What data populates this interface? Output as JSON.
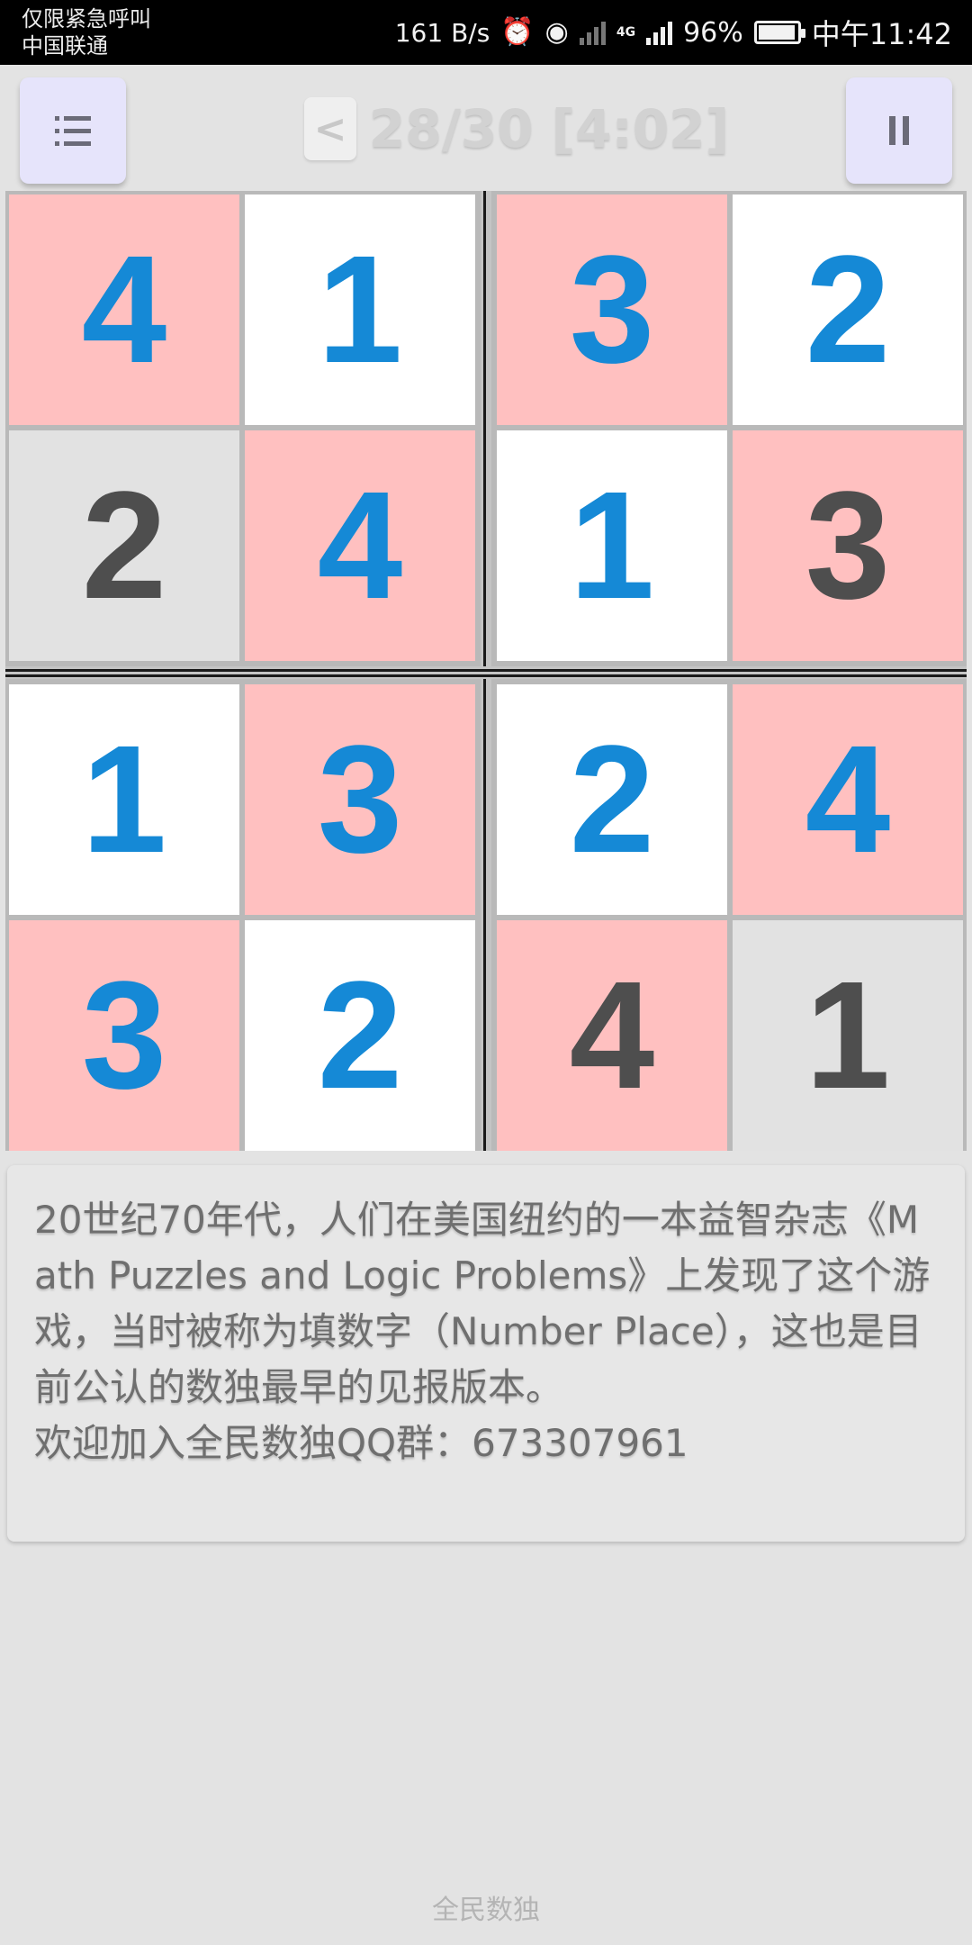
{
  "status_bar": {
    "line1": "仅限紧急呼叫",
    "line2": "中国联通",
    "speed": "161 B/s",
    "network": "4G",
    "battery": "96%",
    "battery_level": 0.96,
    "time": "中午11:42"
  },
  "header": {
    "back_label": "<",
    "progress": "28/30 [4:02]"
  },
  "colors": {
    "pink": "#ffc0c0",
    "white": "#ffffff",
    "grey": "#e2e2e2",
    "blue": "#1589d6",
    "dark": "#4e4e4e"
  },
  "grid": {
    "rows": [
      [
        {
          "value": "4",
          "bg": "pink",
          "fg": "blue"
        },
        {
          "value": "1",
          "bg": "white",
          "fg": "blue"
        },
        {
          "value": "3",
          "bg": "pink",
          "fg": "blue"
        },
        {
          "value": "2",
          "bg": "white",
          "fg": "blue"
        }
      ],
      [
        {
          "value": "2",
          "bg": "grey",
          "fg": "dark"
        },
        {
          "value": "4",
          "bg": "pink",
          "fg": "blue"
        },
        {
          "value": "1",
          "bg": "white",
          "fg": "blue"
        },
        {
          "value": "3",
          "bg": "pink",
          "fg": "dark"
        }
      ],
      [
        {
          "value": "1",
          "bg": "white",
          "fg": "blue"
        },
        {
          "value": "3",
          "bg": "pink",
          "fg": "blue"
        },
        {
          "value": "2",
          "bg": "white",
          "fg": "blue"
        },
        {
          "value": "4",
          "bg": "pink",
          "fg": "blue"
        }
      ],
      [
        {
          "value": "3",
          "bg": "pink",
          "fg": "blue"
        },
        {
          "value": "2",
          "bg": "white",
          "fg": "blue"
        },
        {
          "value": "4",
          "bg": "pink",
          "fg": "dark"
        },
        {
          "value": "1",
          "bg": "grey",
          "fg": "dark"
        }
      ]
    ]
  },
  "info": {
    "paragraph": "20世纪70年代，人们在美国纽约的一本益智杂志《Math Puzzles and Logic Problems》上发现了这个游戏，当时被称为填数字（Number Place），这也是目前公认的数独最早的见报版本。",
    "qq_line": "欢迎加入全民数独QQ群：673307961"
  },
  "footer": {
    "label": "全民数独"
  }
}
